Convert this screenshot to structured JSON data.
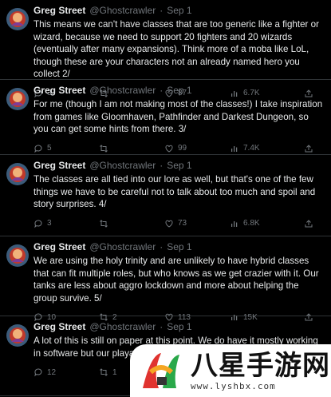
{
  "tweets": [
    {
      "name": "Greg Street",
      "handle": "@Ghostcrawler",
      "dot": "·",
      "date": "Sep 1",
      "text": "This means we can't have classes that are too generic like a fighter or wizard, because we need to support 20 fighters and 20 wizards (eventually after many expansions). Think more of a moba like LoL, though these are your characters not an already named hero you collect 2/",
      "replies": "3",
      "retweets": "",
      "likes": "87",
      "views": "6.7K"
    },
    {
      "name": "Greg Street",
      "handle": "@Ghostcrawler",
      "dot": "·",
      "date": "Sep 1",
      "text": "For me (though I am not making most of the classes!) I take inspiration from games like Gloomhaven, Pathfinder and Darkest Dungeon, so you can get some hints from there. 3/",
      "replies": "5",
      "retweets": "",
      "likes": "99",
      "views": "7.4K"
    },
    {
      "name": "Greg Street",
      "handle": "@Ghostcrawler",
      "dot": "·",
      "date": "Sep 1",
      "text": "The classes are all tied into our lore as well, but that's one of the few things we have to be careful not to talk about too much and spoil and story surprises. 4/",
      "replies": "3",
      "retweets": "",
      "likes": "73",
      "views": "6.8K"
    },
    {
      "name": "Greg Street",
      "handle": "@Ghostcrawler",
      "dot": "·",
      "date": "Sep 1",
      "text": "We are using the holy trinity and are unlikely to have hybrid classes that can fit multiple roles, but who knows as we get crazier with it. Our tanks are less about aggro lockdown and more about helping the group survive. 5/",
      "replies": "10",
      "retweets": "2",
      "likes": "113",
      "views": "15K"
    },
    {
      "name": "Greg Street",
      "handle": "@Ghostcrawler",
      "dot": "·",
      "date": "Sep 1",
      "text": "A lot of this is still on paper at this point. We do have it mostly working in software but our playable ... be ideas we have to pivot ... thread/",
      "replies": "12",
      "retweets": "1",
      "likes": "",
      "views": ""
    }
  ],
  "watermark": {
    "big": "八星手游网",
    "url": "www.lyshbx.com"
  }
}
